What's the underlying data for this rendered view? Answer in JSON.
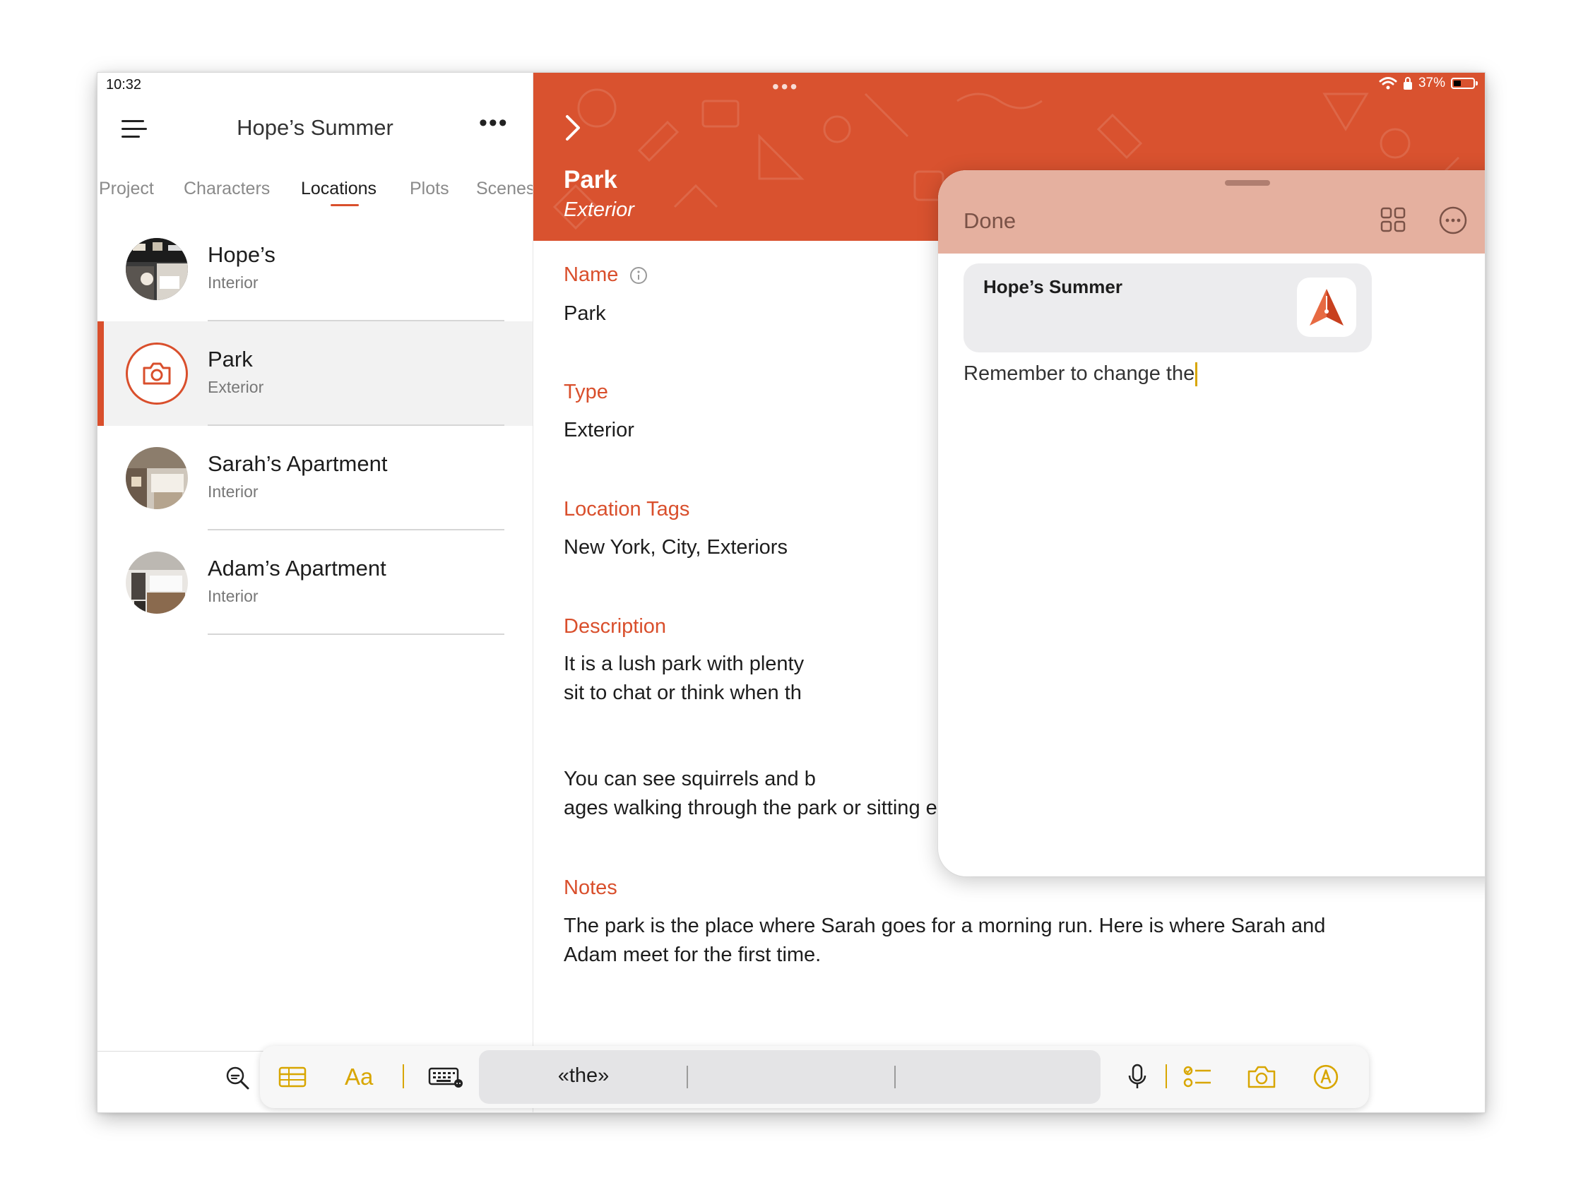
{
  "status_bar": {
    "time": "10:32",
    "battery": "37%",
    "battery_level": 0.37
  },
  "sidebar": {
    "title": "Hope’s Summer",
    "more": "•••",
    "tabs": [
      {
        "label": "Project"
      },
      {
        "label": "Characters"
      },
      {
        "label": "Locations",
        "active": true
      },
      {
        "label": "Plots"
      },
      {
        "label": "Scenes"
      }
    ],
    "locations": [
      {
        "name": "Hope’s",
        "type": "Interior"
      },
      {
        "name": "Park",
        "type": "Exterior",
        "selected": true
      },
      {
        "name": "Sarah’s Apartment",
        "type": "Interior"
      },
      {
        "name": "Adam’s Apartment",
        "type": "Interior"
      }
    ]
  },
  "detail": {
    "title": "Park",
    "subtitle": "Exterior",
    "fields": {
      "name_label": "Name",
      "name_value": "Park",
      "type_label": "Type",
      "type_value": "Exterior",
      "tags_label": "Location Tags",
      "tags_value": "New York, City, Exteriors",
      "description_label": "Description",
      "description_line1": "It is a lush park with plenty",
      "description_line2": "sit to chat or think when th",
      "description_line3": "You can see squirrels and b",
      "description_line4": "ages walking through the park or sitting enjoying the place.",
      "notes_label": "Notes",
      "notes_line1": "The park is the place where Sarah goes for a morning run. Here is where Sarah and",
      "notes_line2": "Adam meet for the first time."
    }
  },
  "quick_note": {
    "done_label": "Done",
    "link_title": "Hope’s Summer",
    "text": "Remember to change the"
  },
  "keyboard_bar": {
    "aa_label": "Aa",
    "prediction": "«the»"
  },
  "colors": {
    "accent": "#d94f2c",
    "note_header": "#e5b09f",
    "toolbar_icons": "#d8a600"
  },
  "icons": [
    "menu-icon",
    "more-icon",
    "camera-icon",
    "zoom-out-icon",
    "chevron-right-icon",
    "info-icon",
    "grid-icon",
    "ellipsis-circle-icon",
    "compose-icon",
    "app-logo-icon",
    "markup-icon",
    "table-icon",
    "keyboard-icon",
    "microphone-icon",
    "checklist-icon",
    "camera-icon",
    "markup-icon",
    "wifi-icon",
    "battery-icon"
  ]
}
